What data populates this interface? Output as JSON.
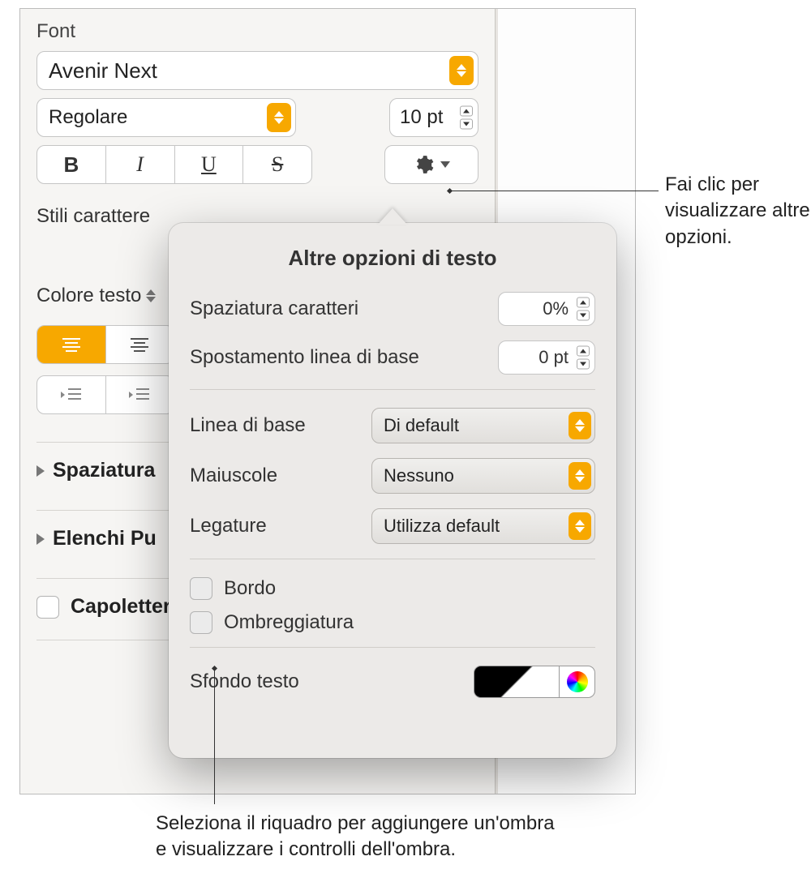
{
  "sidebar": {
    "font_section_label": "Font",
    "font_family": "Avenir Next",
    "font_style": "Regolare",
    "font_size": "10 pt",
    "style_buttons": {
      "bold": "B",
      "italic": "I",
      "underline": "U",
      "strike": "S"
    },
    "char_styles_label": "Stili carattere",
    "text_color_label": "Colore testo",
    "accordion": {
      "spacing": "Spaziatura",
      "lists": "Elenchi Pu",
      "dropcap": "Capoletter"
    }
  },
  "popover": {
    "title": "Altre opzioni di testo",
    "char_spacing_label": "Spaziatura caratteri",
    "char_spacing_value": "0%",
    "baseline_shift_label": "Spostamento linea di base",
    "baseline_shift_value": "0 pt",
    "baseline_label": "Linea di base",
    "baseline_value": "Di default",
    "caps_label": "Maiuscole",
    "caps_value": "Nessuno",
    "ligatures_label": "Legature",
    "ligatures_value": "Utilizza default",
    "outline_label": "Bordo",
    "shadow_label": "Ombreggiatura",
    "text_bg_label": "Sfondo testo"
  },
  "callouts": {
    "right": "Fai clic per visualizzare altre opzioni.",
    "bottom": "Seleziona il riquadro per aggiungere un'ombra e visualizzare i controlli dell'ombra."
  }
}
